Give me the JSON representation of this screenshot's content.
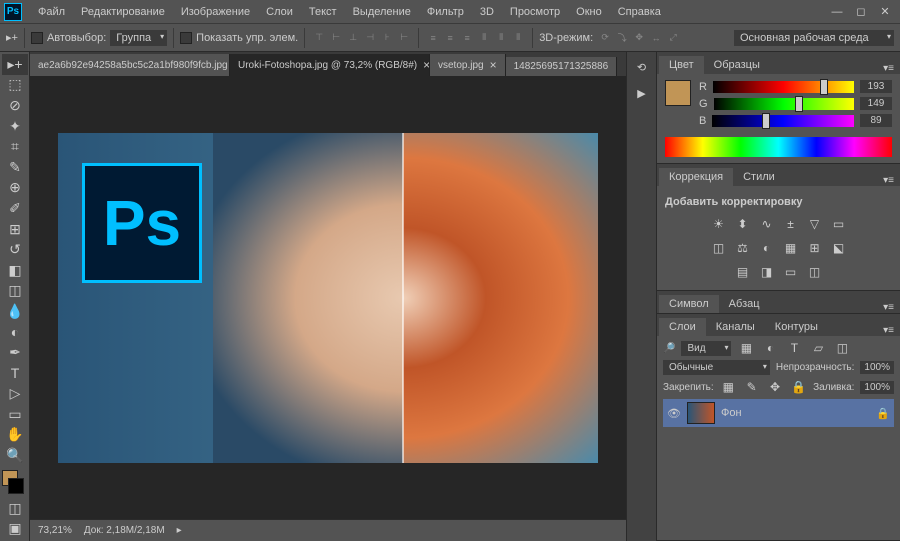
{
  "app": {
    "logo": "Ps"
  },
  "menu": [
    "Файл",
    "Редактирование",
    "Изображение",
    "Слои",
    "Текст",
    "Выделение",
    "Фильтр",
    "3D",
    "Просмотр",
    "Окно",
    "Справка"
  ],
  "optbar": {
    "autoselect": "Автовыбор:",
    "group": "Группа",
    "show_controls": "Показать упр. элем.",
    "mode3d": "3D-режим:",
    "workspace": "Основная рабочая среда"
  },
  "tabs": [
    {
      "label": "ae2a6b92e94258a5bc5c2a1bf980f9fcb.jpg",
      "active": false
    },
    {
      "label": "Uroki-Fotoshopa.jpg @ 73,2% (RGB/8#)",
      "active": true
    },
    {
      "label": "vsetop.jpg",
      "active": false
    },
    {
      "label": "14825695171325886",
      "active": false
    }
  ],
  "status": {
    "zoom": "73,21%",
    "doc": "Док: 2,18M/2,18M"
  },
  "color": {
    "tab1": "Цвет",
    "tab2": "Образцы",
    "r": {
      "label": "R",
      "val": "193",
      "pct": 76
    },
    "g": {
      "label": "G",
      "val": "149",
      "pct": 58
    },
    "b": {
      "label": "B",
      "val": "89",
      "pct": 35
    }
  },
  "correction": {
    "tab1": "Коррекция",
    "tab2": "Стили",
    "title": "Добавить корректировку"
  },
  "char": {
    "tab1": "Символ",
    "tab2": "Абзац"
  },
  "layers": {
    "tab1": "Слои",
    "tab2": "Каналы",
    "tab3": "Контуры",
    "kind": "Вид",
    "blend": "Обычные",
    "opacity_label": "Непрозрачность:",
    "opacity": "100%",
    "lock_label": "Закрепить:",
    "fill_label": "Заливка:",
    "fill": "100%",
    "layer_name": "Фон"
  },
  "ps_badge": "Ps"
}
